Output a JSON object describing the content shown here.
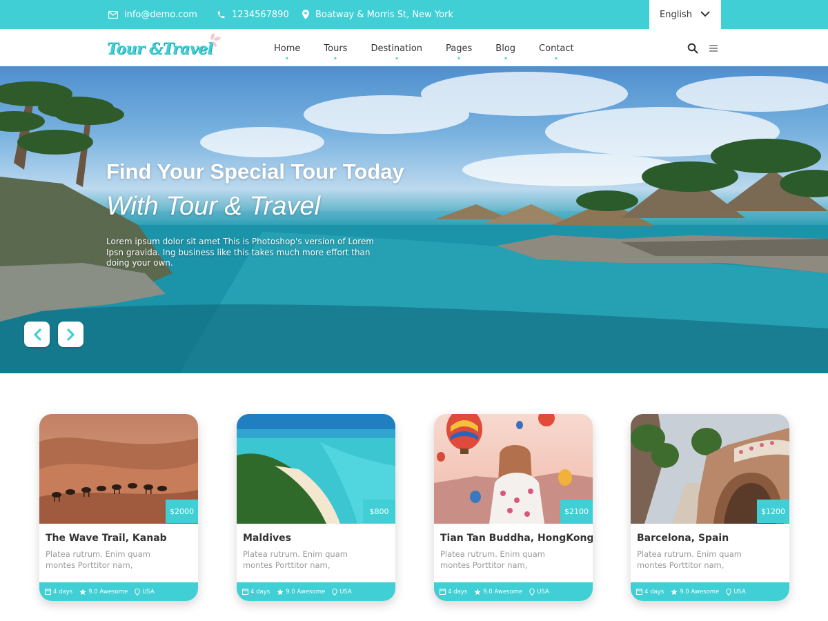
{
  "topbar": {
    "email": "info@demo.com",
    "phone": "1234567890",
    "address": "Boatway & Morris St, New York",
    "language": "English"
  },
  "header": {
    "logo_text": "Tour &Travel",
    "nav": [
      "Home",
      "Tours",
      "Destination",
      "Pages",
      "Blog",
      "Contact"
    ]
  },
  "hero": {
    "title": "Find Your Special Tour Today",
    "subtitle": "With Tour & Travel",
    "description": "Lorem ipsum dolor sit amet This is Photoshop's version of Lorem Ipsn gravida. Ing business like this takes much more effort than doing your own."
  },
  "cards": [
    {
      "title": "The Wave Trail, Kanab",
      "price": "$2000",
      "desc": "Platea rutrum. Enim quam montes Porttitor nam,",
      "days": "4 days",
      "rating": "9.0 Awesome",
      "location": "USA"
    },
    {
      "title": "Maldives",
      "price": "$800",
      "desc": "Platea rutrum. Enim quam montes Porttitor nam,",
      "days": "4 days",
      "rating": "9.0 Awesome",
      "location": "USA"
    },
    {
      "title": "Tian Tan Buddha, HongKong",
      "price": "$2100",
      "desc": "Platea rutrum. Enim quam montes Porttitor nam,",
      "days": "4 days",
      "rating": "9.0 Awesome",
      "location": "USA"
    },
    {
      "title": "Barcelona, Spain",
      "price": "$1200",
      "desc": "Platea rutrum. Enim quam montes Porttitor nam,",
      "days": "4 days",
      "rating": "9.0 Awesome",
      "location": "USA"
    }
  ],
  "icons": {
    "email": "mail-icon",
    "phone": "phone-icon",
    "address": "location-pin-icon",
    "language": "chevron-down-icon",
    "search": "search-icon",
    "menu": "menu-icon",
    "prev": "chevron-left-icon",
    "next": "chevron-right-icon",
    "days": "calendar-icon",
    "rating": "star-icon",
    "location": "location-pin-icon"
  },
  "colors": {
    "accent": "#3fcfd4",
    "text": "#333333",
    "muted": "#9a9a9a"
  }
}
